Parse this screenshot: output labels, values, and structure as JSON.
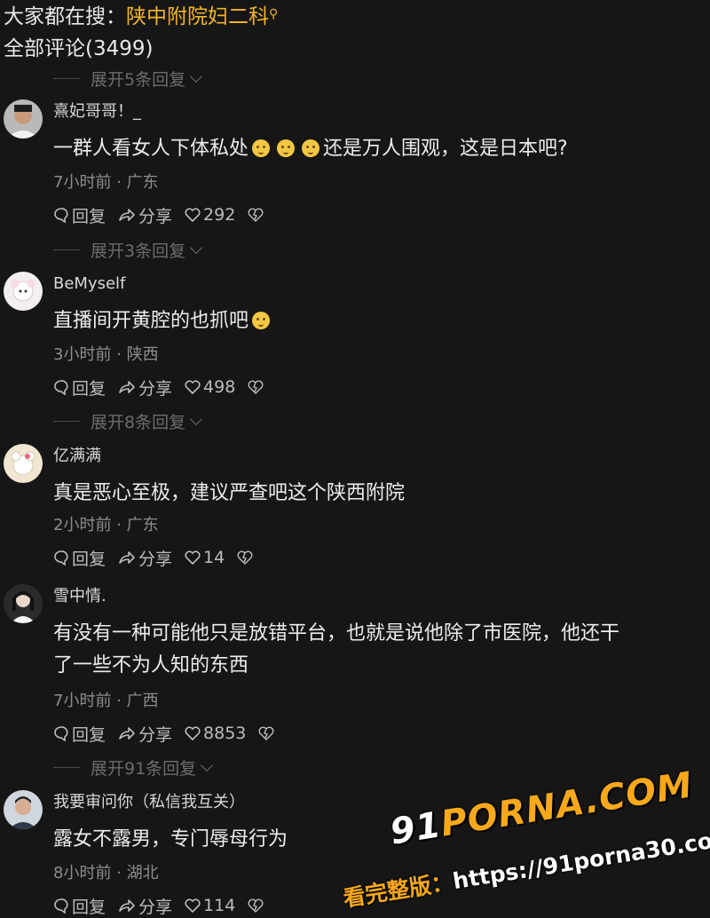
{
  "search_bar": {
    "prefix": "大家都在搜：",
    "query": "陕中附院妇二科",
    "icon": "search-icon"
  },
  "comment_count": "全部评论(3499)",
  "expand_labels": [
    "展开5条回复",
    "展开3条回复",
    "展开8条回复",
    "展开91条回复"
  ],
  "actions": {
    "reply": "回复",
    "share": "分享"
  },
  "comments": [
    {
      "user": "熹妃哥哥！_",
      "text_before": "一群人看女人下体私处",
      "text_after": "还是万人围观，这是日本吧?",
      "time": "7小时前 · 广东",
      "likes": "292"
    },
    {
      "user": "BeMyself",
      "text_before": "直播间开黄腔的也抓吧",
      "text_after": "",
      "time": "3小时前 · 陕西",
      "likes": "498"
    },
    {
      "user": "亿满满",
      "text_before": "真是恶心至极，建议严查吧这个陕西附院",
      "text_after": "",
      "time": "2小时前 · 广东",
      "likes": "14"
    },
    {
      "user": "雪中情.",
      "text_before": "有没有一种可能他只是放错平台，也就是说他除了市医院，他还干",
      "text_line2": "了一些不为人知的东西",
      "time": "7小时前 · 广西",
      "likes": "8853"
    },
    {
      "user": "我要审问你（私信我互关）",
      "text_before": "露女不露男，专门辱母行为",
      "text_after": "",
      "time": "8小时前 · 湖北",
      "likes": "114"
    }
  ],
  "watermark": {
    "logo_91": "91",
    "logo_rest": "PORNA.COM",
    "label": "看完整版：",
    "url": "https://91porna30.com"
  },
  "colors": {
    "background": "#161616",
    "highlight": "#f0b428",
    "meta": "#8d8d8d"
  }
}
